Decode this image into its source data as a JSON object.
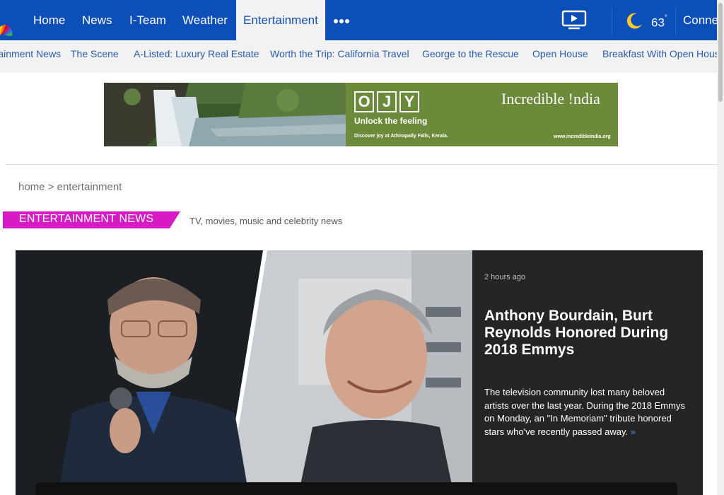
{
  "topnav": {
    "items": [
      {
        "label": "Home"
      },
      {
        "label": "News"
      },
      {
        "label": "I-Team"
      },
      {
        "label": "Weather"
      },
      {
        "label": "Entertainment",
        "active": true
      }
    ],
    "more_icon": "more-dots-icon",
    "video_icon": "video-play-icon",
    "weather_icon": "moon-icon",
    "temperature": "63",
    "degree": "°",
    "connect_label": "Connect"
  },
  "subnav": {
    "items": [
      {
        "label": "Entertainment News"
      },
      {
        "label": "The Scene"
      },
      {
        "label": "A-Listed: Luxury Real Estate"
      },
      {
        "label": "Worth the Trip: California Travel"
      },
      {
        "label": "George to the Rescue"
      },
      {
        "label": "Open House"
      },
      {
        "label": "Breakfast With Open House"
      }
    ]
  },
  "ad": {
    "letters": [
      "O",
      "J",
      "Y"
    ],
    "tagline": "Unlock the feeling",
    "fine_print": "Discover joy at Athirapally Falls, Kerala.",
    "brand": "Incredible !ndia",
    "url": "www.incredibleindia.org"
  },
  "breadcrumb": "home > entertainment",
  "section": {
    "title": "ENTERTAINMENT NEWS",
    "subtitle": "TV, movies, music and celebrity news"
  },
  "hero": {
    "time_ago": "2 hours ago",
    "headline": "Anthony Bourdain, Burt Reynolds Honored During 2018 Emmys",
    "summary": "The television community lost many beloved artists over the last year. During the 2018 Emmys on Monday, an \"In Memoriam\" tribute honored stars who've recently passed away.",
    "more_link": "»"
  },
  "colors": {
    "nav_blue": "#0d4fb8",
    "accent_magenta": "#d61bc5",
    "panel_dark": "#252525"
  }
}
